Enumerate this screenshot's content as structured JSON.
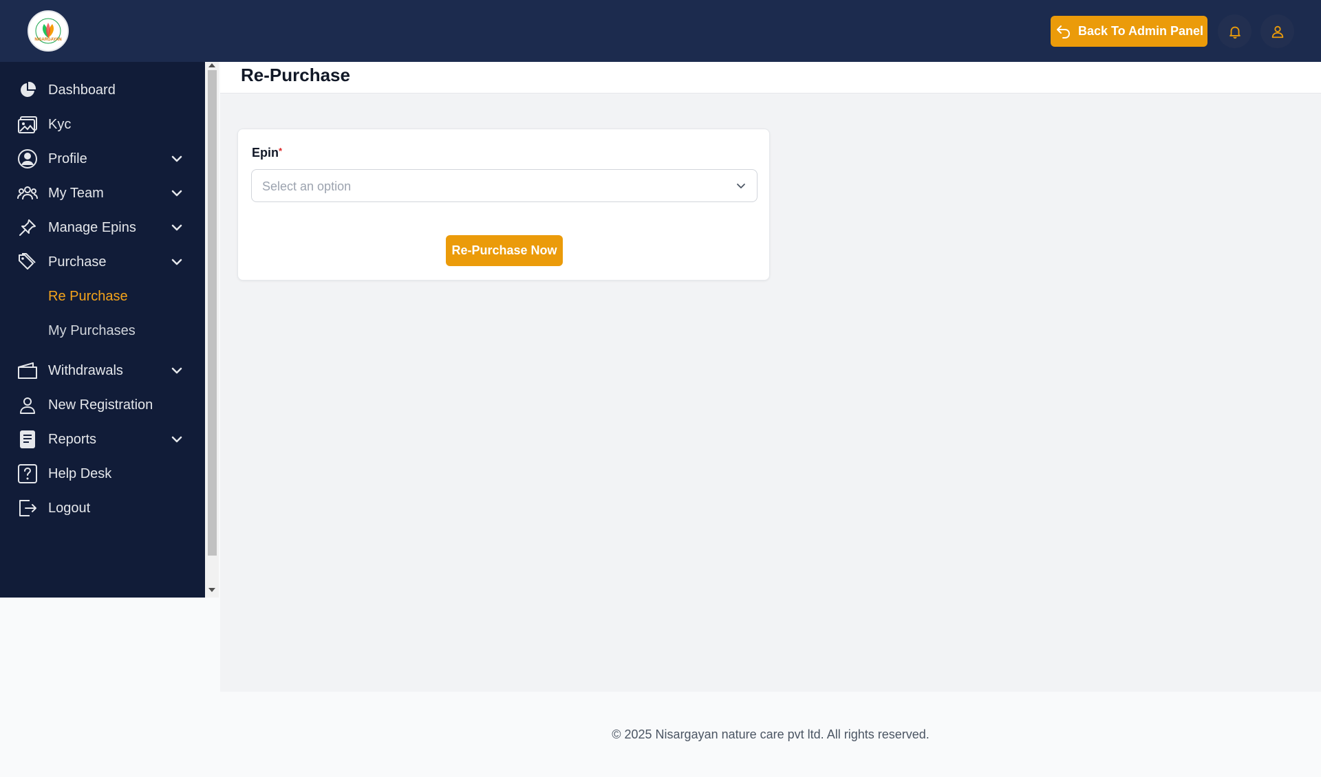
{
  "header": {
    "logo_text": "NISARGAYAN",
    "back_button_label": "Back To Admin Panel",
    "notification_icon": "bell-icon",
    "user_icon": "user-icon",
    "accent_color": "#eb9b0a",
    "bg_color": "#1c2b4e"
  },
  "sidebar": {
    "items": [
      {
        "label": "Dashboard",
        "icon": "pie-chart-icon"
      },
      {
        "label": "Kyc",
        "icon": "image-icon"
      },
      {
        "label": "Profile",
        "icon": "user-circle-icon",
        "expandable": true
      },
      {
        "label": "My Team",
        "icon": "team-icon",
        "expandable": true
      },
      {
        "label": "Manage Epins",
        "icon": "pin-icon",
        "expandable": true
      },
      {
        "label": "Purchase",
        "icon": "tag-icon",
        "expandable": true,
        "expanded": true
      },
      {
        "label": "Withdrawals",
        "icon": "wallet-icon",
        "expandable": true
      },
      {
        "label": "New Registration",
        "icon": "user-add-icon"
      },
      {
        "label": "Reports",
        "icon": "document-icon",
        "expandable": true
      },
      {
        "label": "Help Desk",
        "icon": "help-icon"
      },
      {
        "label": "Logout",
        "icon": "logout-icon"
      }
    ],
    "purchase_subitems": [
      {
        "label": "Re Purchase",
        "active": true
      },
      {
        "label": "My Purchases",
        "active": false
      }
    ],
    "active_color": "#f5a41b"
  },
  "main": {
    "page_title": "Re-Purchase",
    "form": {
      "epin_label": "Epin",
      "required_marker": "*",
      "epin_placeholder": "Select an option",
      "submit_label": "Re-Purchase Now"
    }
  },
  "footer": {
    "copyright": "© 2025 Nisargayan nature care pvt ltd. All rights reserved."
  }
}
